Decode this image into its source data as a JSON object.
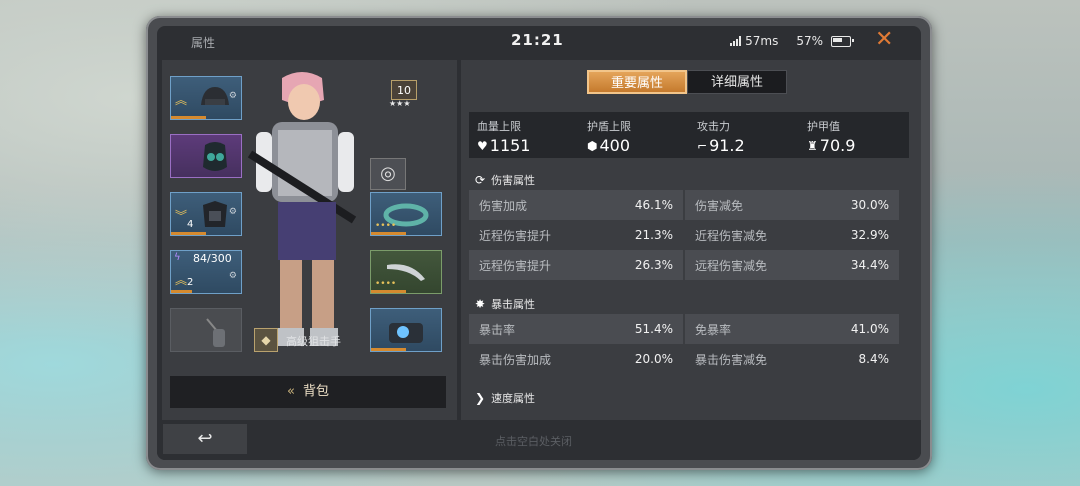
{
  "header": {
    "title": "属性",
    "time": "21:21",
    "ping": "57ms",
    "battery": "57%",
    "close_icon": "close-icon"
  },
  "equipment": {
    "level": "10",
    "stars": "★★★",
    "ammo": "84/300",
    "helmet_count": "",
    "armor_count": "4",
    "weapon_count": "2",
    "role_label": "高级狙击手",
    "bag_button": "背包"
  },
  "tabs": [
    {
      "label": "重要属性",
      "active": true
    },
    {
      "label": "详细属性",
      "active": false
    }
  ],
  "main_stats": [
    {
      "label": "血量上限",
      "value": "1151",
      "icon": "heart-icon"
    },
    {
      "label": "护盾上限",
      "value": "400",
      "icon": "shield-icon"
    },
    {
      "label": "攻击力",
      "value": "91.2",
      "icon": "gun-icon"
    },
    {
      "label": "护甲值",
      "value": "70.9",
      "icon": "armor-icon"
    }
  ],
  "sections": {
    "damage": {
      "title": "伤害属性",
      "rows": [
        [
          {
            "name": "伤害加成",
            "value": "46.1%"
          },
          {
            "name": "伤害减免",
            "value": "30.0%"
          }
        ],
        [
          {
            "name": "近程伤害提升",
            "value": "21.3%"
          },
          {
            "name": "近程伤害减免",
            "value": "32.9%"
          }
        ],
        [
          {
            "name": "远程伤害提升",
            "value": "26.3%"
          },
          {
            "name": "远程伤害减免",
            "value": "34.4%"
          }
        ]
      ]
    },
    "crit": {
      "title": "暴击属性",
      "rows": [
        [
          {
            "name": "暴击率",
            "value": "51.4%"
          },
          {
            "name": "免暴率",
            "value": "41.0%"
          }
        ],
        [
          {
            "name": "暴击伤害加成",
            "value": "20.0%"
          },
          {
            "name": "暴击伤害减免",
            "value": "8.4%"
          }
        ]
      ]
    },
    "speed": {
      "title": "速度属性"
    }
  },
  "footer": {
    "hint": "点击空白处关闭"
  },
  "colors": {
    "accent": "#e07a35",
    "tab_active": "#d98f42",
    "panel": "#3b3d41"
  }
}
